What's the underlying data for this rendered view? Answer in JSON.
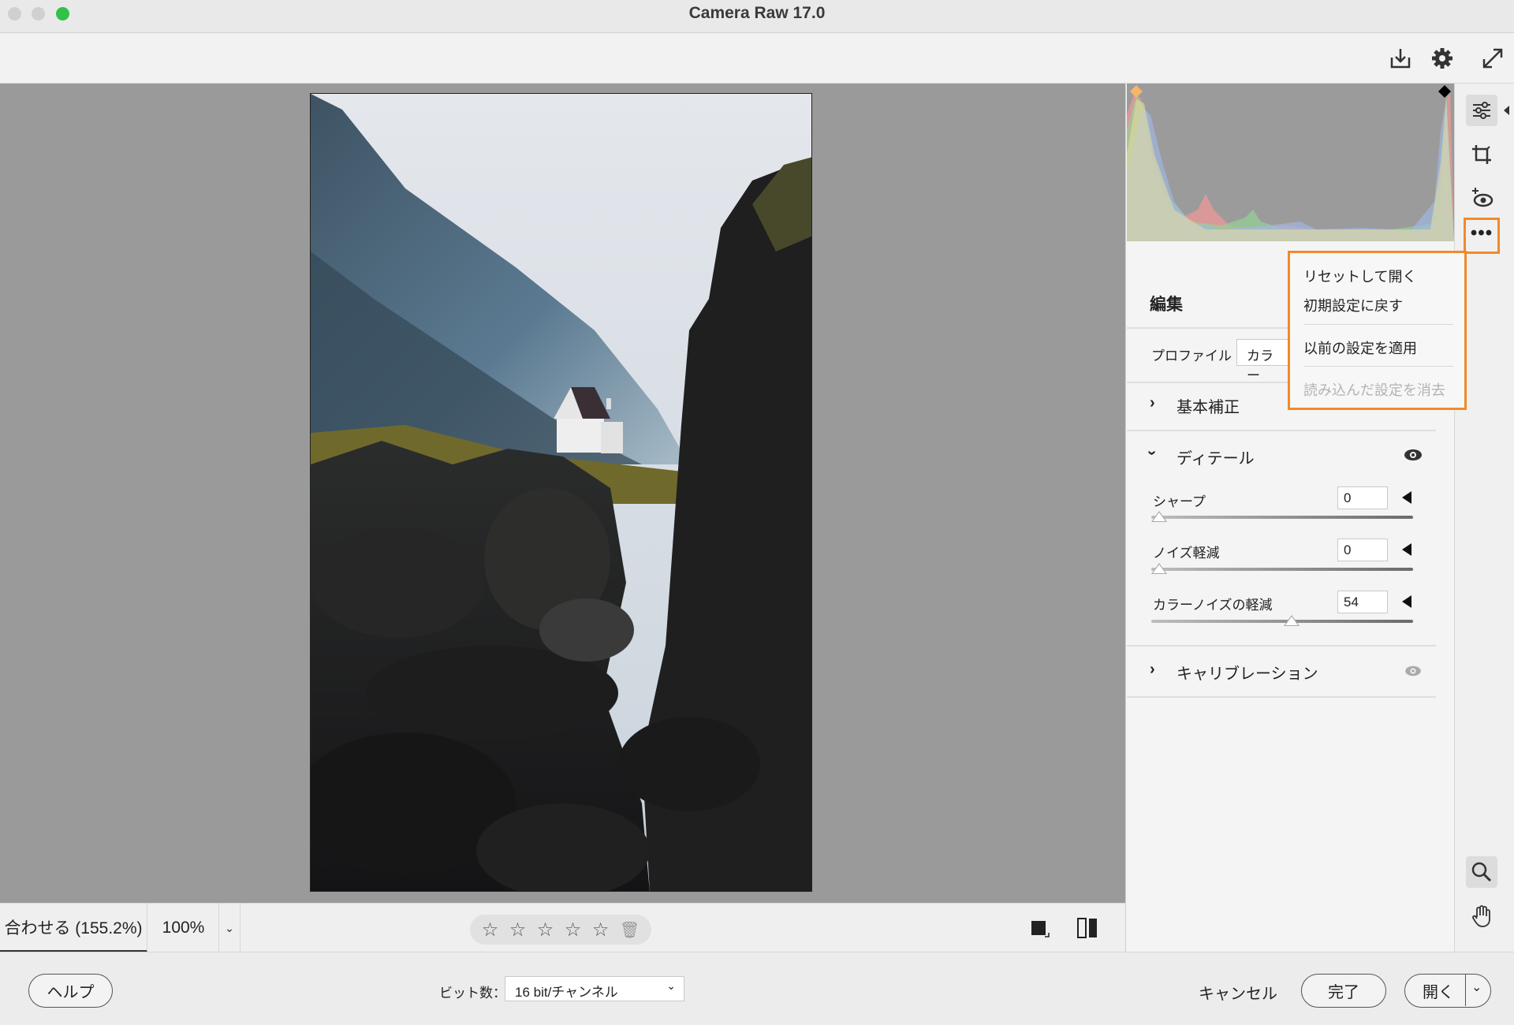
{
  "window": {
    "title": "Camera Raw 17.0"
  },
  "toolbar": {
    "save_icon": "download-tray-icon",
    "settings_icon": "gear-icon",
    "fullscreen_icon": "expand-arrows-icon"
  },
  "viewbar": {
    "fit_label": "合わせる (155.2%)",
    "zoom_label": "100%",
    "stars": [
      "☆",
      "☆",
      "☆",
      "☆",
      "☆"
    ]
  },
  "panel": {
    "edit_title": "編集",
    "profile_label": "プロファイル",
    "profile_value": "カラー",
    "sections": {
      "basic": "基本補正",
      "detail": "ディテール",
      "calibration": "キャリブレーション"
    },
    "sliders": [
      {
        "label": "シャープ",
        "value": "0",
        "fraction": 0.0
      },
      {
        "label": "ノイズ軽減",
        "value": "0",
        "fraction": 0.0
      },
      {
        "label": "カラーノイズの軽減",
        "value": "54",
        "fraction": 0.54
      }
    ]
  },
  "menu": {
    "items": [
      "リセットして開く",
      "初期設定に戻す",
      "以前の設定を適用",
      "読み込んだ設定を消去"
    ]
  },
  "footer": {
    "help_label": "ヘルプ",
    "bitdepth_label": "ビット数：",
    "bitdepth_value": "16 bit/チャンネル",
    "cancel_label": "キャンセル",
    "done_label": "完了",
    "open_label": "開く"
  },
  "colors": {
    "accent_orange": "#f08a2a",
    "canvas_gray": "#9a9a9a"
  }
}
